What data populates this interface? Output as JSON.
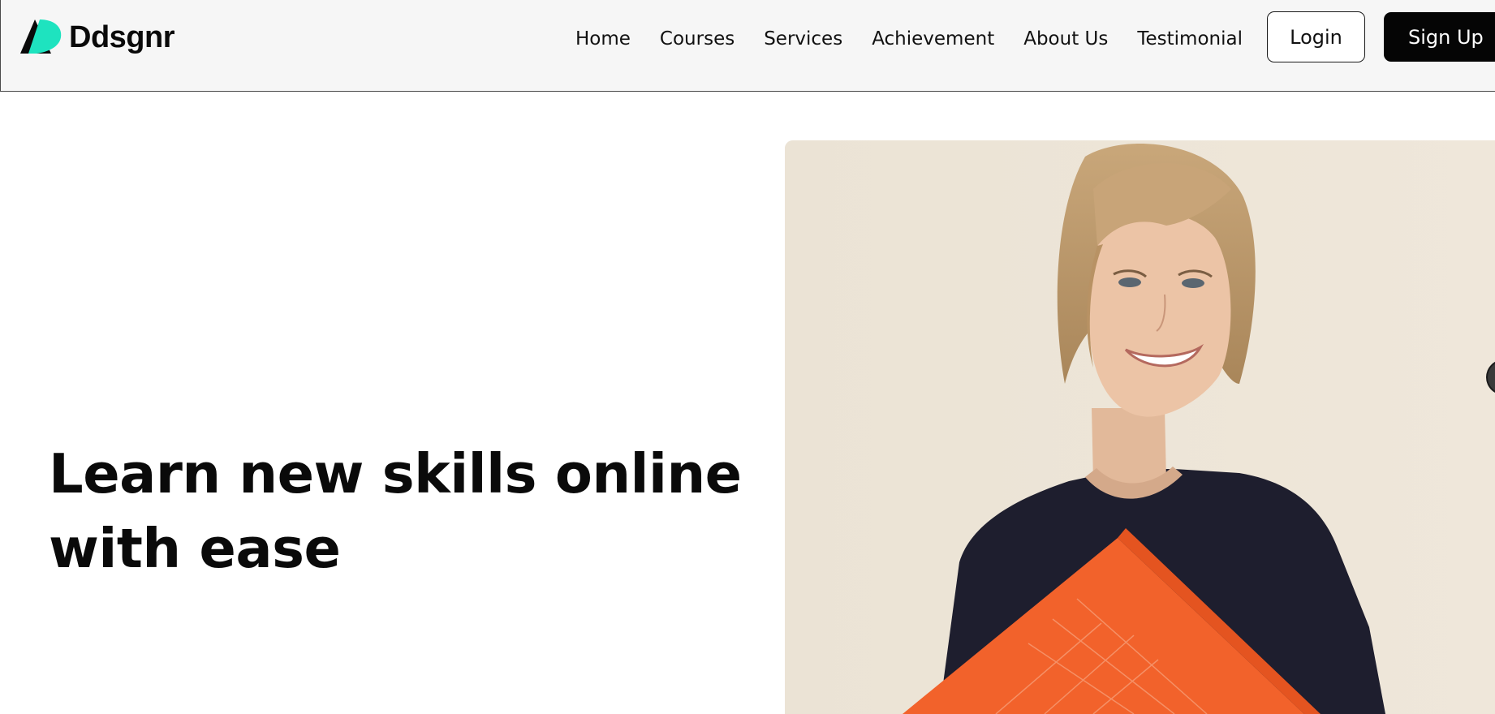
{
  "brand": {
    "name": "Ddsgnr",
    "accent_color": "#1ee3bf",
    "logo_icon": "ddsgnr-logo-icon"
  },
  "nav": {
    "links": [
      "Home",
      "Courses",
      "Services",
      "Achievement",
      "About Us",
      "Testimonial"
    ]
  },
  "auth": {
    "login_label": "Login",
    "signup_label": "Sign Up"
  },
  "hero": {
    "heading_line1": "Learn new skills online",
    "heading_line2": "with ease",
    "image_subject": "smiling woman holding orange folder"
  },
  "colors": {
    "navbar_bg": "#f6f6f6",
    "signup_bg": "#050505",
    "text": "#0a0a0a",
    "image_bg": "#ebe3d6",
    "folder_orange": "#f2622b",
    "shirt_navy": "#1e1e2e"
  }
}
